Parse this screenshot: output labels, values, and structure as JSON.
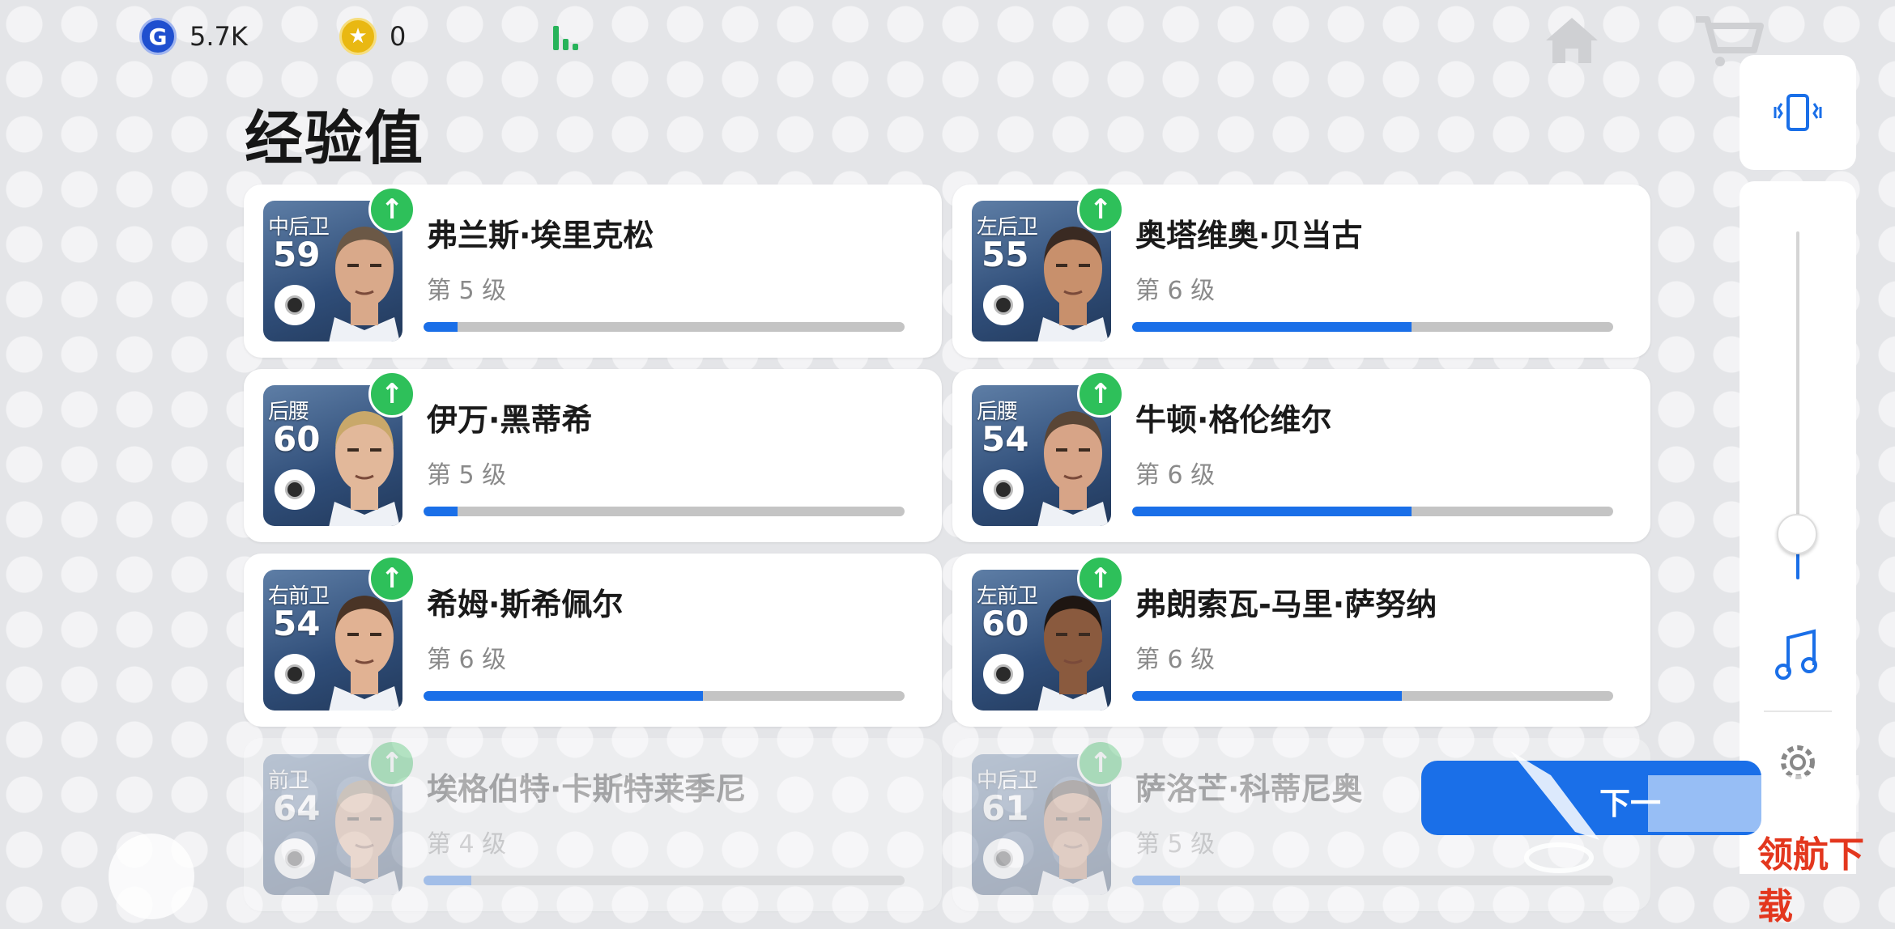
{
  "currency": {
    "gp_value": "5.7K",
    "coin_value": "0"
  },
  "page_title": "经验值",
  "colors": {
    "progress_fill": "#1a6fe8",
    "progress_track": "#c4c4c4",
    "up_badge": "#2ec05a",
    "card_bg": "#ffffff"
  },
  "players": [
    {
      "position": "中后卫",
      "rating": "59",
      "name": "弗兰斯·埃里克松",
      "level": "第 5 级",
      "progress": 0.07
    },
    {
      "position": "左后卫",
      "rating": "55",
      "name": "奥塔维奥·贝当古",
      "level": "第 6 级",
      "progress": 0.58
    },
    {
      "position": "后腰",
      "rating": "60",
      "name": "伊万·黑蒂希",
      "level": "第 5 级",
      "progress": 0.07
    },
    {
      "position": "后腰",
      "rating": "54",
      "name": "牛顿·格伦维尔",
      "level": "第 6 级",
      "progress": 0.58
    },
    {
      "position": "右前卫",
      "rating": "54",
      "name": "希姆·斯希佩尔",
      "level": "第 6 级",
      "progress": 0.58
    },
    {
      "position": "左前卫",
      "rating": "60",
      "name": "弗朗索瓦-马里·萨努纳",
      "level": "第 6 级",
      "progress": 0.56
    },
    {
      "position": "前卫",
      "rating": "64",
      "name": "埃格伯特·卡斯特莱季尼",
      "level": "第 4 级",
      "progress": 0.1
    },
    {
      "position": "中后卫",
      "rating": "61",
      "name": "萨洛芒·科蒂尼奥",
      "level": "第 5 级",
      "progress": 0.1
    }
  ],
  "next_button_label": "下一",
  "watermark_text": "领航下载",
  "icons": {
    "gp": "G",
    "coin": "★",
    "up": "↑",
    "home": "home-icon",
    "cart": "cart-icon",
    "vibrate": "vibrate-icon",
    "music": "music-icon",
    "settings": "gear-icon"
  },
  "volume_level": 0.13
}
